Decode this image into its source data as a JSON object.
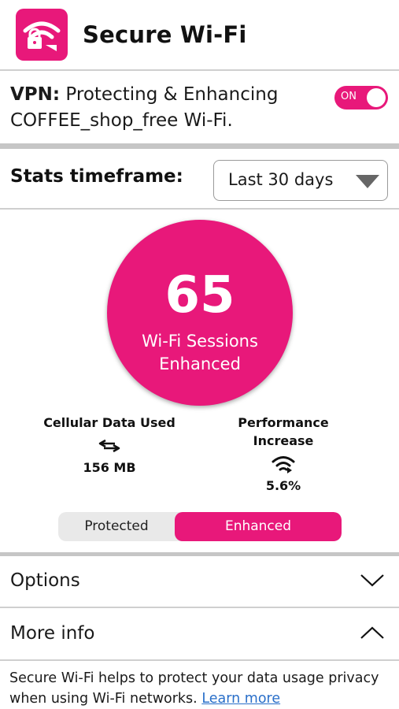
{
  "header": {
    "title": "Secure Wi-Fi",
    "icon": "wifi-lock-icon",
    "accent": "#e8187a"
  },
  "vpn": {
    "label": "VPN:",
    "status_text": "Protecting & Enhancing",
    "network": "COFFEE_shop_free Wi-Fi.",
    "toggle_label": "ON",
    "toggle_on": true
  },
  "stats": {
    "label": "Stats timeframe:",
    "selected": "Last 30 days"
  },
  "summary": {
    "sessions": "65",
    "caption": "Wi-Fi Sessions Enhanced"
  },
  "metrics": {
    "cellular": {
      "label": "Cellular Data Used",
      "value": "156 MB",
      "icon": "data-transfer-icon"
    },
    "performance": {
      "label": "Performance Increase",
      "value": "5.6%",
      "icon": "wifi-signal-icon"
    }
  },
  "segment": {
    "protected": "Protected",
    "enhanced": "Enhanced",
    "active": "enhanced"
  },
  "options": {
    "label": "Options",
    "icon": "chevron-down-icon"
  },
  "more_info": {
    "label": "More info",
    "icon": "chevron-up-icon",
    "text": "Secure Wi-Fi helps to protect your data usage privacy when using Wi-Fi networks.",
    "link": "Learn more"
  }
}
